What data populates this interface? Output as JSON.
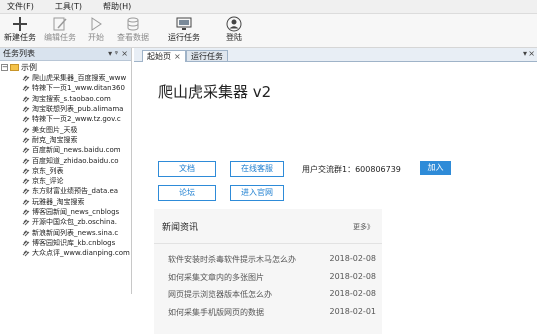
{
  "menu": [
    "文件(F)",
    "工具(T)",
    "帮助(H)"
  ],
  "toolbar": [
    {
      "label": "新建任务",
      "icon": "plus-icon",
      "enabled": true
    },
    {
      "label": "编辑任务",
      "icon": "edit-icon",
      "enabled": false
    },
    {
      "label": "开始",
      "icon": "play-icon",
      "enabled": false
    },
    {
      "label": "查看数据",
      "icon": "database-icon",
      "enabled": false
    },
    {
      "label": "运行任务",
      "icon": "monitor-icon",
      "enabled": true
    },
    {
      "label": "登陆",
      "icon": "user-icon",
      "enabled": true
    }
  ],
  "sidebar": {
    "title": "任务列表",
    "pin_glyph": "▾ ᵠ",
    "close_glyph": "×",
    "root_label": "示例",
    "items": [
      "爬山虎采集器_百度搜索_www",
      "特辣下一页1_www.ditan360",
      "淘宝搜索_s.taobao.com",
      "淘宝联想列表_pub.alimama",
      "特辣下一页2_www.tz.gov.c",
      "美女图片_天极",
      "耐克_淘宝搜索",
      "百度新闻_news.baidu.com",
      "百度知道_zhidao.baidu.co",
      "京东_列表",
      "京东_评论",
      "东方财富业绩预告_data.ea",
      "玩雅器_淘宝搜索",
      "博客园新闻_news_cnblogs",
      "开源中国众包_zb.oschina.",
      "新浪新闻列表_news.sina.c",
      "博客园知识库_kb.cnblogs",
      "大众点评_www.dianping.com"
    ]
  },
  "tabs": [
    {
      "label": "起始页",
      "closable": true,
      "active": true
    },
    {
      "label": "运行任务",
      "closable": false,
      "active": false
    }
  ],
  "start": {
    "title": "爬山虎采集器 v2",
    "buttons": [
      "文档",
      "在线客服",
      "论坛",
      "进入官网"
    ],
    "group_label": "用户交流群1：600806739",
    "join_label": "加入"
  },
  "news": {
    "header": "新闻资讯",
    "more": "更多》",
    "items": [
      {
        "title": "软件安装时杀毒软件提示木马怎么办",
        "date": "2018-02-08"
      },
      {
        "title": "如何采集文章内的多张图片",
        "date": "2018-02-08"
      },
      {
        "title": "网页提示浏览器版本低怎么办",
        "date": "2018-02-08"
      },
      {
        "title": "如何采集手机版网页的数据",
        "date": "2018-02-01"
      }
    ]
  },
  "colors": {
    "accent": "#2e8bd8",
    "panel_header": "#d9e3ee"
  }
}
